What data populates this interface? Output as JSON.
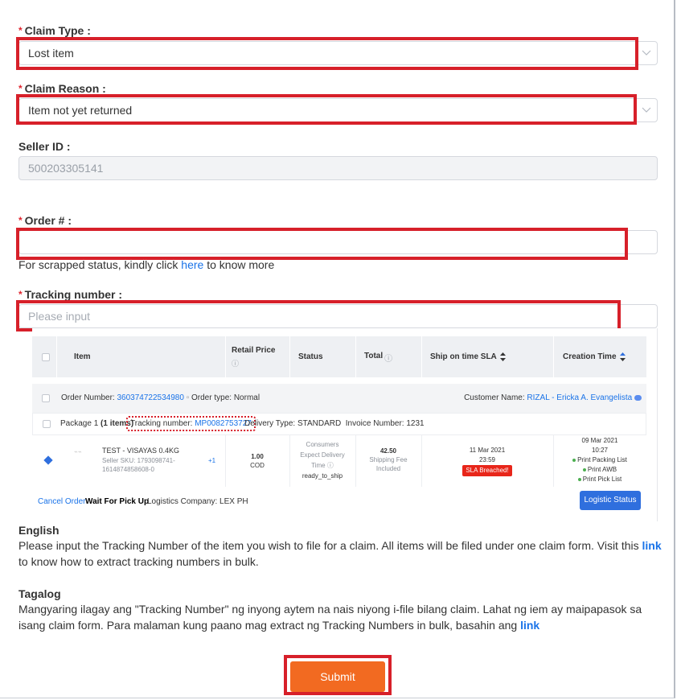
{
  "form": {
    "claim_type": {
      "label": "Claim Type",
      "value": "Lost item"
    },
    "claim_reason": {
      "label": "Claim Reason",
      "value": "Item not yet returned"
    },
    "seller_id": {
      "label": "Seller ID",
      "value": "500203305141"
    },
    "order_no": {
      "label": "Order #",
      "value": ""
    },
    "hint": {
      "before": "For scrapped status, kindly click ",
      "link": "here",
      "after": " to know more"
    },
    "tracking": {
      "label": "Tracking number",
      "placeholder": "Please input"
    },
    "submit_label": "Submit",
    "colon": ":",
    "required_mark": "*"
  },
  "example": {
    "headers": {
      "item": "Item",
      "retail_price": "Retail Price",
      "status": "Status",
      "total": "Total",
      "ship_sla": "Ship on time SLA",
      "creation_time": "Creation Time"
    },
    "order": {
      "number_label": "Order Number:",
      "number": "360374722534980",
      "type_label": "Order type:",
      "type": "Normal",
      "customer_label": "Customer Name:",
      "customer": "RIZAL - Ericka A. Evangelista"
    },
    "package": {
      "label": "Package 1",
      "items": "(1 items)",
      "tracking_label": "Tracking number:",
      "tracking": "MP0082753727",
      "delivery": "Delivery Type: STANDARD",
      "invoice": "Invoice Number: 1231"
    },
    "item": {
      "name": "TEST - VISAYAS 0.4KG",
      "sku_line1": "Seller SKU: 1793098741-",
      "sku_line2": "1614874858608-0",
      "extra": "+1",
      "price": "1.00",
      "payment": "COD",
      "status_l1": "Consumers",
      "status_l2": "Expect Delivery",
      "status_l3": "Time",
      "status_l4": "ready_to_ship",
      "total": "42.50",
      "fee_l1": "Shipping Fee",
      "fee_l2": "Included",
      "sla_date": "11 Mar 2021",
      "sla_time": "23:59",
      "sla_badge": "SLA Breached!",
      "created_date": "09 Mar 2021",
      "created_time": "10:27",
      "act1": "Print Packing List",
      "act2": "Print AWB",
      "act3": "Print Pick List"
    },
    "footer": {
      "cancel": "Cancel Order",
      "status": "Wait For Pick Up",
      "logistics": "Logistics Company: LEX PH",
      "logistic_btn": "Logistic Status"
    }
  },
  "english": {
    "title": "English",
    "text": "Please input the Tracking Number of the item you wish to file for a claim. All items will be filed under one claim form. Visit this ",
    "link": "link",
    "after": " to know how to extract tracking numbers in bulk."
  },
  "tagalog": {
    "title": "Tagalog",
    "text": "Mangyaring ilagay ang \"Tracking Number\" ng inyong aytem na nais niyong i-file bilang claim. Lahat ng iem ay maipapasok sa isang claim form. Para malaman kung paano mag extract ng Tracking Numbers in bulk, basahin ang ",
    "link": "link"
  },
  "colors": {
    "highlight": "#d7202a",
    "submit": "#f26a21",
    "link": "#1a73e8"
  }
}
